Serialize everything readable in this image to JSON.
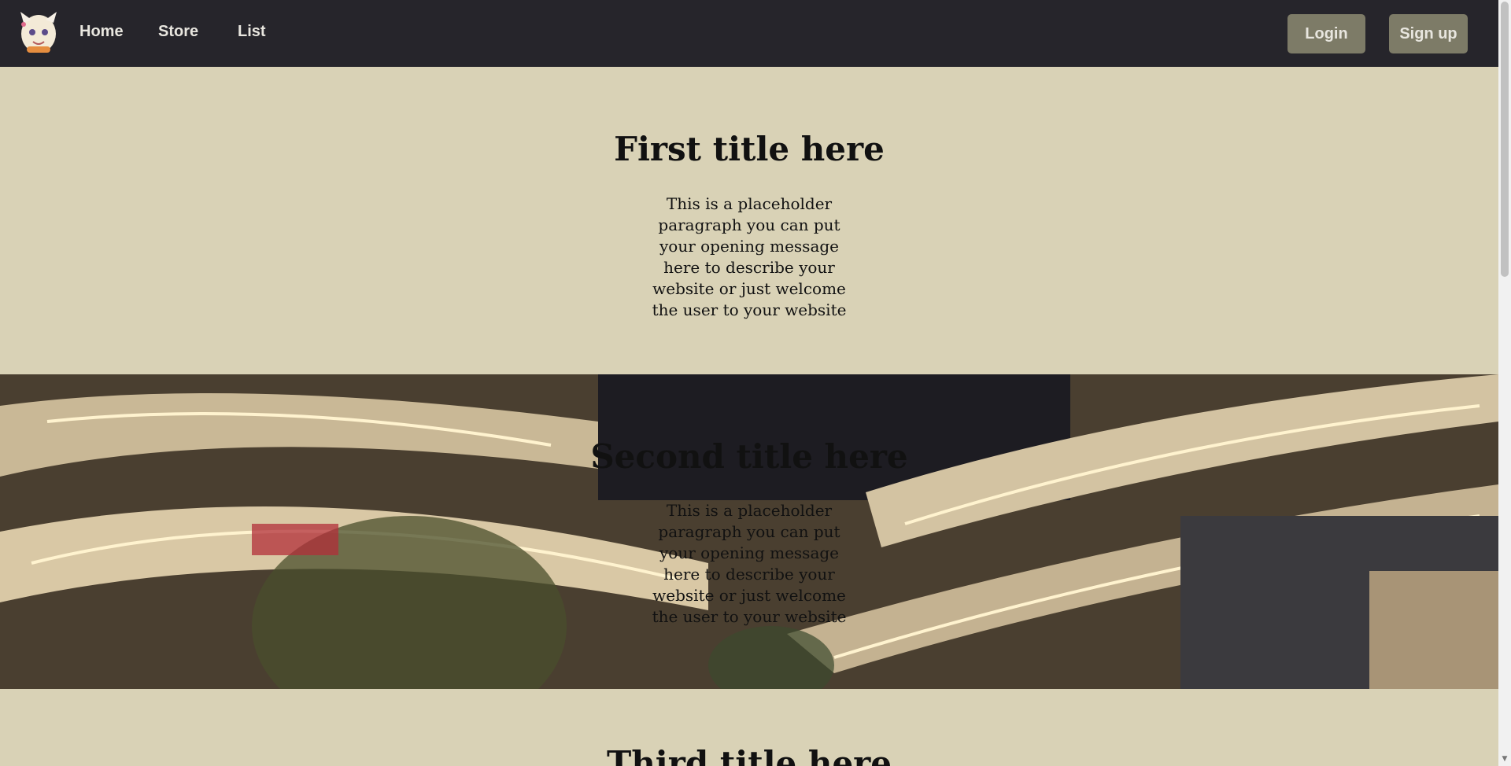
{
  "nav": {
    "links": [
      "Home",
      "Store",
      "List"
    ],
    "login_label": "Login",
    "signup_label": "Sign up"
  },
  "sections": [
    {
      "title": "First title here",
      "text": "This is a placeholder paragraph you can put your opening message here to describe your website or just welcome the user to your website"
    },
    {
      "title": "Second title here",
      "text": "This is a placeholder paragraph you can put your opening message here to describe your website or just welcome the user to your website"
    },
    {
      "title": "Third title here"
    }
  ],
  "colors": {
    "navbar": "#26252b",
    "page_background": "#d9d2b6",
    "button": "#7d7b67",
    "nav_text": "#e8e6df"
  },
  "icons": {
    "logo": "cartoon-mascot-logo",
    "scrollbar_down": "arrow-down-icon"
  }
}
